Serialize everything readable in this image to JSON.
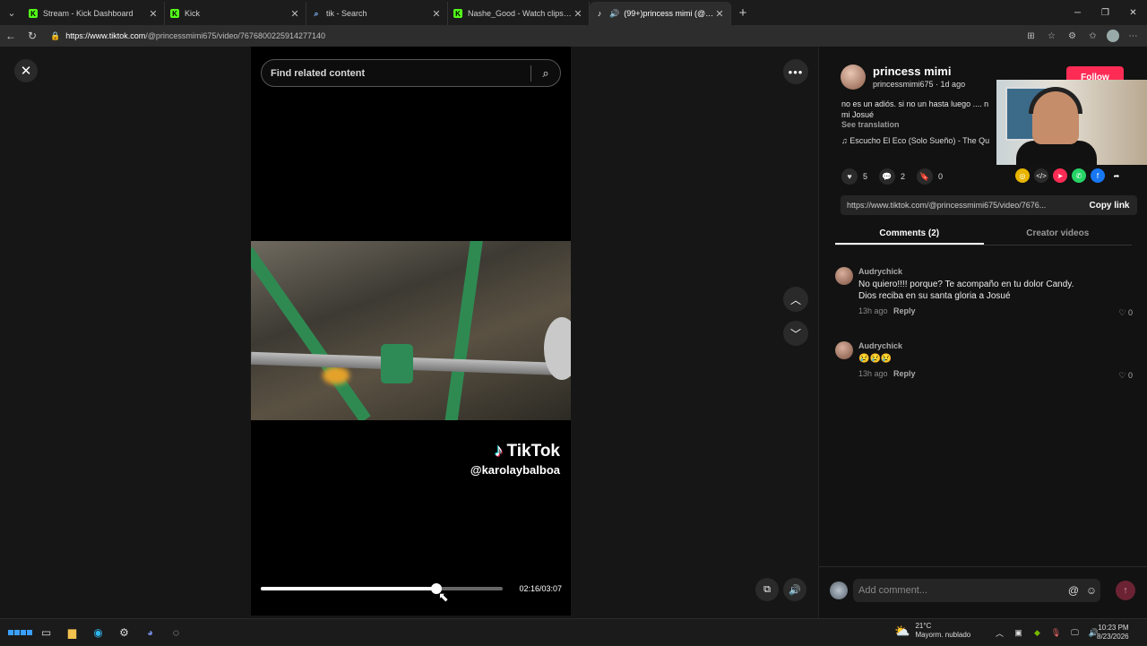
{
  "browser": {
    "tabs": [
      {
        "label": "Stream - Kick Dashboard",
        "icon": "kick-icon",
        "active": false
      },
      {
        "label": "Kick",
        "icon": "kick-icon",
        "active": false
      },
      {
        "label": "tik - Search",
        "icon": "search-icon",
        "active": false
      },
      {
        "label": "Nashe_Good - Watch clips on Kick",
        "icon": "kick-icon",
        "active": false
      },
      {
        "label": "(99+)princess mimi (@princess",
        "icon": "tiktok-icon",
        "active": true
      }
    ],
    "url_host": "https://www.tiktok.com",
    "url_path": "/@princessmimi675/video/7676800225914277140"
  },
  "player": {
    "search_placeholder": "Find related content",
    "watermark_brand": "TikTok",
    "watermark_user": "@karolaybalboa",
    "timecode": "02:16/03:07",
    "progress_fraction": 0.727
  },
  "post": {
    "author_name": "princess mimi",
    "author_handle": "princessmimi675",
    "posted": "1d ago",
    "follow_label": "Follow",
    "description_line1": "no es un adiós. si no un hasta luego .... n",
    "description_line2": "mi Josué",
    "see_translation": "See translation",
    "music": "Escucho El Eco (Solo Sueño) - The Qu",
    "likes": "5",
    "comments_count": "2",
    "saves": "0",
    "link": "https://www.tiktok.com/@princessmimi675/video/7676...",
    "copy_link_label": "Copy link"
  },
  "panel_tabs": {
    "comments": "Comments (2)",
    "creator_videos": "Creator videos"
  },
  "comments": [
    {
      "user": "Audrychick",
      "text": "No quiero!!!! porque? Te acompaño en tu dolor Candy. Dios reciba en su santa gloria a Josué",
      "ago": "13h ago",
      "reply": "Reply",
      "likes": "0"
    },
    {
      "user": "Audrychick",
      "text": "😢😢😢",
      "ago": "13h ago",
      "reply": "Reply",
      "likes": "0"
    }
  ],
  "add_comment": {
    "placeholder": "Add comment..."
  },
  "taskbar": {
    "temperature": "21°C",
    "weather": "Mayorm. nublado",
    "time": "10:23 PM",
    "date": "8/23/2026"
  },
  "colors": {
    "accent": "#fe2c55",
    "kick_green": "#53fc18",
    "background": "#121212"
  }
}
